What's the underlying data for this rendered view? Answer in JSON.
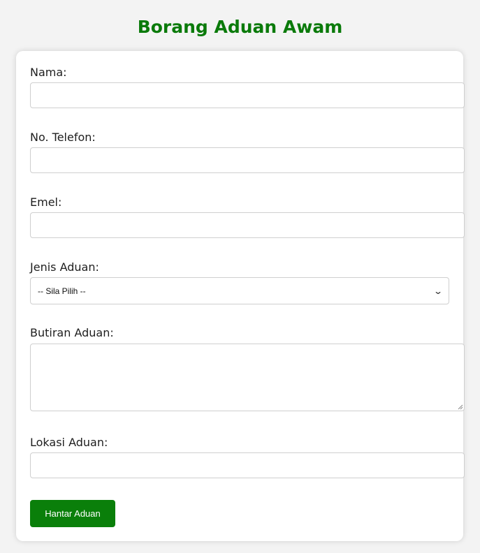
{
  "page": {
    "title": "Borang Aduan Awam",
    "accent_color": "#0a7a0a"
  },
  "form": {
    "fields": {
      "nama": {
        "label": "Nama:",
        "value": ""
      },
      "telefon": {
        "label": "No. Telefon:",
        "value": ""
      },
      "emel": {
        "label": "Emel:",
        "value": ""
      },
      "jenis": {
        "label": "Jenis Aduan:",
        "selected": "-- Sila Pilih --"
      },
      "butiran": {
        "label": "Butiran Aduan:",
        "value": ""
      },
      "lokasi": {
        "label": "Lokasi Aduan:",
        "value": ""
      }
    },
    "submit_label": "Hantar Aduan",
    "icons": {
      "select_arrow": "chevron-down-icon",
      "textarea_grip": "resize-grip-icon"
    }
  }
}
